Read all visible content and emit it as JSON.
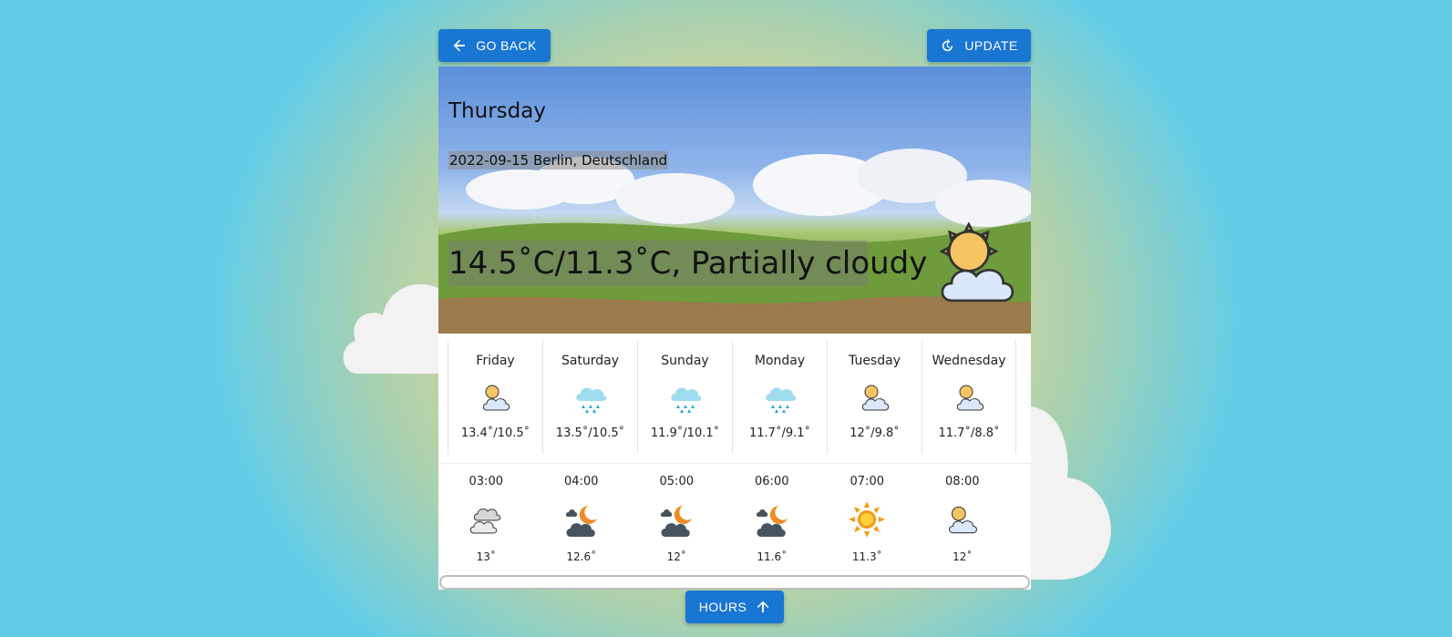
{
  "toolbar": {
    "back_label": "GO BACK",
    "update_label": "UPDATE"
  },
  "current": {
    "day": "Thursday",
    "date_location": "2022-09-15 Berlin, Deutschland",
    "summary": "14.5˚C/11.3˚C, Partially cloudy",
    "icon": "partly-cloudy-day-icon"
  },
  "daily": [
    {
      "day": "Friday",
      "temps": "13.4˚/10.5˚",
      "icon": "partly-cloudy-day-icon"
    },
    {
      "day": "Saturday",
      "temps": "13.5˚/10.5˚",
      "icon": "rain-icon"
    },
    {
      "day": "Sunday",
      "temps": "11.9˚/10.1˚",
      "icon": "rain-icon"
    },
    {
      "day": "Monday",
      "temps": "11.7˚/9.1˚",
      "icon": "rain-icon"
    },
    {
      "day": "Tuesday",
      "temps": "12˚/9.8˚",
      "icon": "partly-cloudy-day-icon"
    },
    {
      "day": "Wednesday",
      "temps": "11.7˚/8.8˚",
      "icon": "partly-cloudy-day-icon"
    }
  ],
  "hourly": [
    {
      "time": "03:00",
      "temp": "13˚",
      "icon": "cloudy-icon"
    },
    {
      "time": "04:00",
      "temp": "12.6˚",
      "icon": "partly-cloudy-night-icon"
    },
    {
      "time": "05:00",
      "temp": "12˚",
      "icon": "partly-cloudy-night-icon"
    },
    {
      "time": "06:00",
      "temp": "11.6˚",
      "icon": "partly-cloudy-night-icon"
    },
    {
      "time": "07:00",
      "temp": "11.3˚",
      "icon": "sun-icon"
    },
    {
      "time": "08:00",
      "temp": "12˚",
      "icon": "partly-cloudy-day-icon"
    }
  ],
  "footer": {
    "hours_label": "HOURS"
  },
  "colors": {
    "accent": "#1976d2",
    "background_center": "#eed68a",
    "background_edge": "#64cde6"
  }
}
